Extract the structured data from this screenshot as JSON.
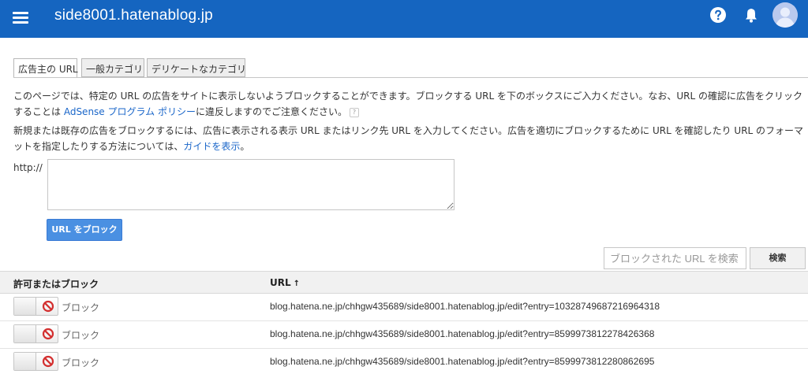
{
  "header": {
    "site_title": "side8001.hatenablog.jp",
    "menu_icon": "hamburger-menu-icon",
    "help_icon": "help-icon",
    "notification_icon": "bell-icon",
    "account_icon": "avatar-icon",
    "bar_color": "#1565c0"
  },
  "tabs": [
    {
      "label": "広告主の URL",
      "active": true
    },
    {
      "label": "一般カテゴリ",
      "active": false
    },
    {
      "label": "デリケートなカテゴリ",
      "active": false
    }
  ],
  "intro": {
    "text_before_link": "このページでは、特定の URL の広告をサイトに表示しないようブロックすることができます。ブロックする URL を下のボックスにご入力ください。なお、URL の確認に広告をクリックすることは ",
    "policy_link": "AdSense プログラム ポリシー",
    "text_after_link": "に違反しますのでご注意ください。",
    "help_mark": "?"
  },
  "instructions": {
    "text_before_link": "新規または既存の広告をブロックするには、広告に表示される表示 URL またはリンク先 URL を入力してください。広告を適切にブロックするために URL を確認したり URL のフォーマットを指定したりする方法については、",
    "guide_link": "ガイドを表示",
    "text_after_link": "。"
  },
  "url_form": {
    "prefix_label": "http://",
    "textarea_value": "",
    "block_button_label": "URL をブロック"
  },
  "search": {
    "placeholder": "ブロックされた URL を検索",
    "button_label": "検索"
  },
  "table": {
    "columns": [
      "許可またはブロック",
      "URL"
    ],
    "sort_indicator": "↑",
    "rows": [
      {
        "status": "ブロック",
        "url": "blog.hatena.ne.jp/chhgw435689/side8001.hatenablog.jp/edit?entry=10328749687216964318"
      },
      {
        "status": "ブロック",
        "url": "blog.hatena.ne.jp/chhgw435689/side8001.hatenablog.jp/edit?entry=8599973812278426368"
      },
      {
        "status": "ブロック",
        "url": "blog.hatena.ne.jp/chhgw435689/side8001.hatenablog.jp/edit?entry=8599973812280862695"
      }
    ]
  },
  "colors": {
    "link": "#1a66c9",
    "primary_button": "#4a90e2",
    "block_icon": "#d32f2f"
  }
}
